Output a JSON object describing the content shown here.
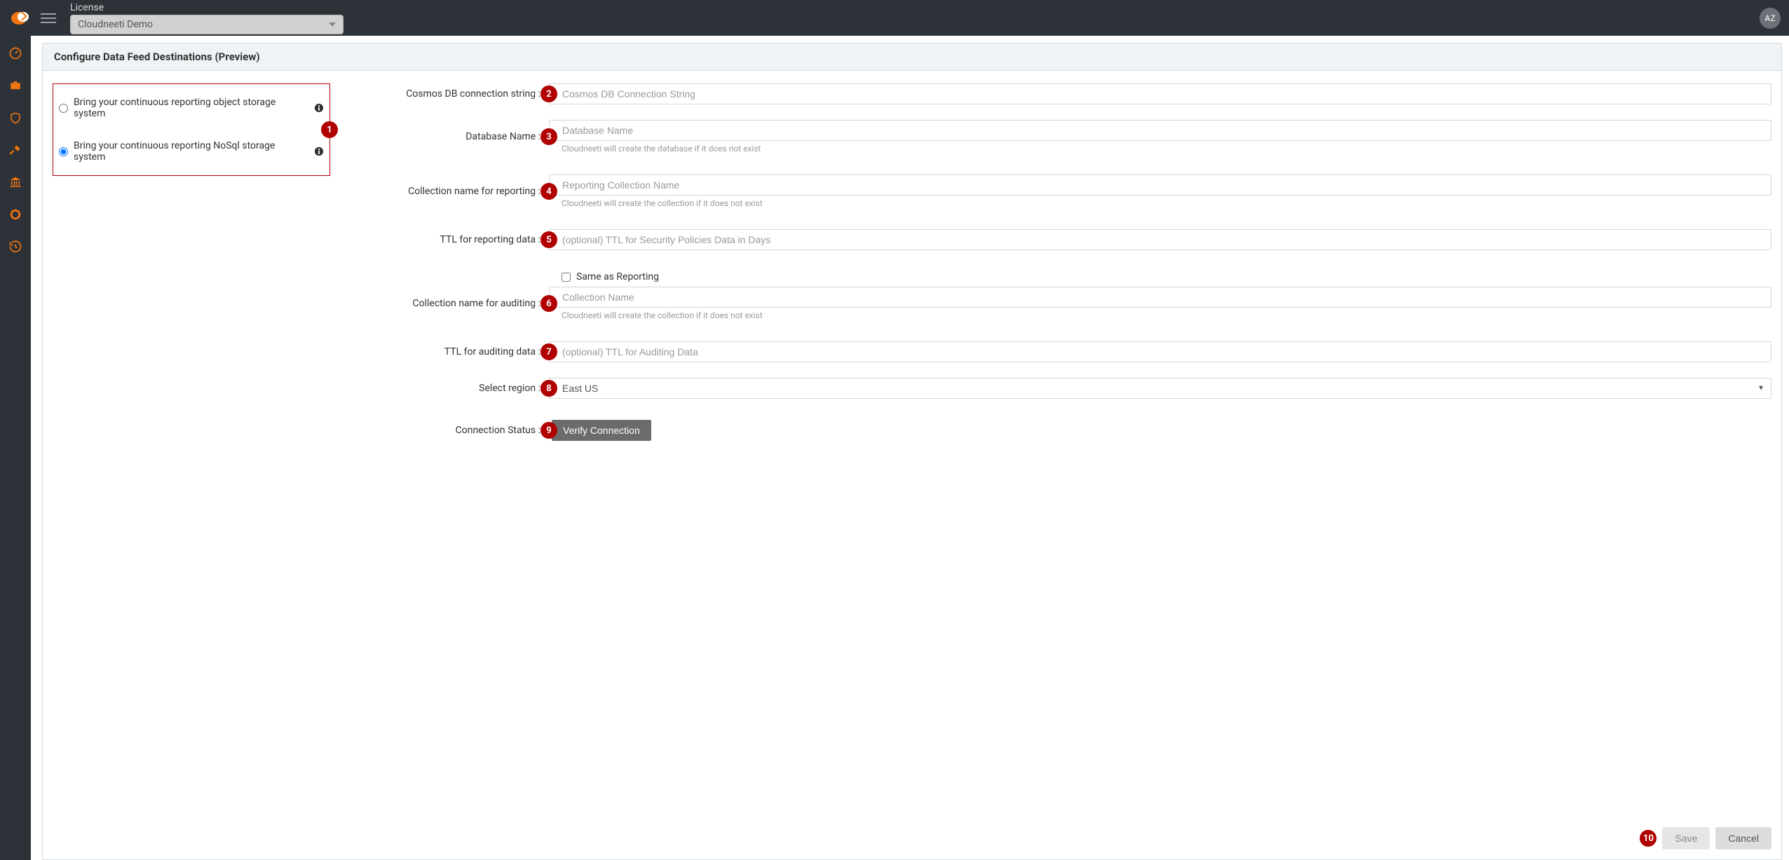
{
  "topbar": {
    "license_label": "License",
    "license_value": "Cloudneeti Demo",
    "avatar_initials": "AZ"
  },
  "page": {
    "title": "Configure Data Feed Destinations (Preview)"
  },
  "storage_options": {
    "opt1_label": "Bring your continuous reporting object storage system",
    "opt2_label": "Bring your continuous reporting NoSql storage system"
  },
  "badges": {
    "b1": "1",
    "b2": "2",
    "b3": "3",
    "b4": "4",
    "b5": "5",
    "b6": "6",
    "b7": "7",
    "b8": "8",
    "b9": "9",
    "b10": "10"
  },
  "form": {
    "cosmos_label": "Cosmos DB connection string :",
    "cosmos_placeholder": "Cosmos DB Connection String",
    "dbname_label": "Database Name :",
    "dbname_placeholder": "Database Name",
    "dbname_hint": "Cloudneeti will create the database if it does not exist",
    "coll_report_label": "Collection name for reporting :",
    "coll_report_placeholder": "Reporting Collection Name",
    "coll_report_hint": "Cloudneeti will create the collection if it does not exist",
    "ttl_report_label": "TTL for reporting data :",
    "ttl_report_placeholder": "(optional) TTL for Security Policies Data in Days",
    "same_as_reporting_label": "Same as Reporting",
    "coll_audit_label": "Collection name for auditing :",
    "coll_audit_placeholder": "Collection Name",
    "coll_audit_hint": "Cloudneeti will create the collection if it does not exist",
    "ttl_audit_label": "TTL for auditing data :",
    "ttl_audit_placeholder": "(optional) TTL for Auditing Data",
    "region_label": "Select region :",
    "region_value": "East US",
    "conn_status_label": "Connection Status :",
    "verify_btn_label": "Verify Connection"
  },
  "footer": {
    "save_label": "Save",
    "cancel_label": "Cancel"
  }
}
